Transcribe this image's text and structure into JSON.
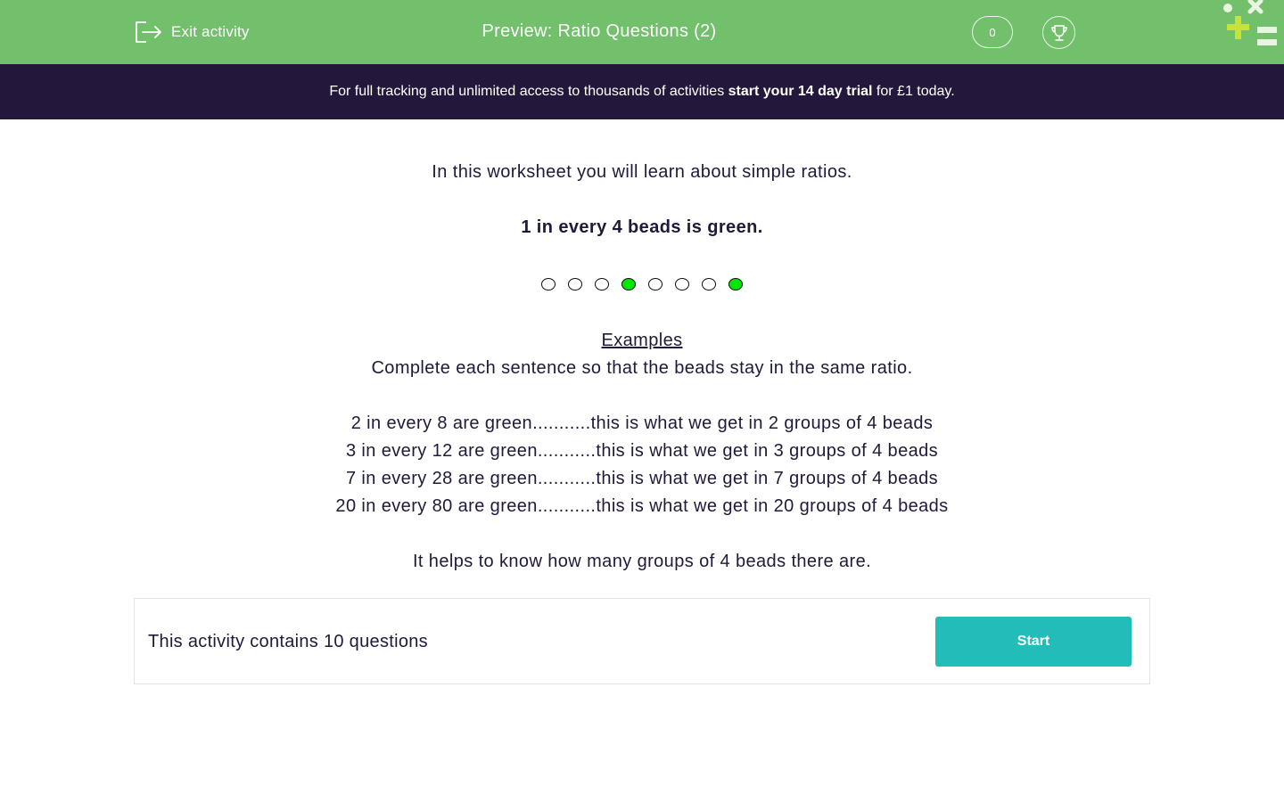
{
  "header": {
    "exit_label": "Exit activity",
    "title": "Preview: Ratio Questions (2)",
    "score": "0",
    "colors": {
      "header_bg": "#72bf6c",
      "banner_bg": "#23183b",
      "accent": "#22bdb9",
      "bead_green": "#00e600"
    }
  },
  "promo": {
    "before": "For full tracking and unlimited access to thousands of activities ",
    "bold": "start your 14 day trial",
    "after": " for £1 today."
  },
  "content": {
    "intro": "In this worksheet you will learn about simple ratios.",
    "statement": "1 in every 4 beads is green.",
    "beads": [
      "white",
      "white",
      "white",
      "green",
      "white",
      "white",
      "white",
      "green"
    ],
    "examples_heading": "Examples",
    "instruction": "Complete each sentence so that the beads stay in the same ratio.",
    "examples": [
      "2 in every 8 are green...........this is what we get in 2 groups of 4 beads",
      "3 in every 12 are green...........this is what we get in 3 groups of 4 beads",
      "7 in every 28 are green...........this is what we get in 7 groups of 4 beads",
      "20 in every 80 are green...........this is what we get in 20 groups of 4 beads"
    ],
    "tip": "It helps to know how many groups of 4 beads there are."
  },
  "panel": {
    "count_text": "This activity contains 10 questions",
    "start_label": "Start"
  },
  "icons": [
    "exit-icon",
    "trophy-icon",
    "logo-icon"
  ]
}
